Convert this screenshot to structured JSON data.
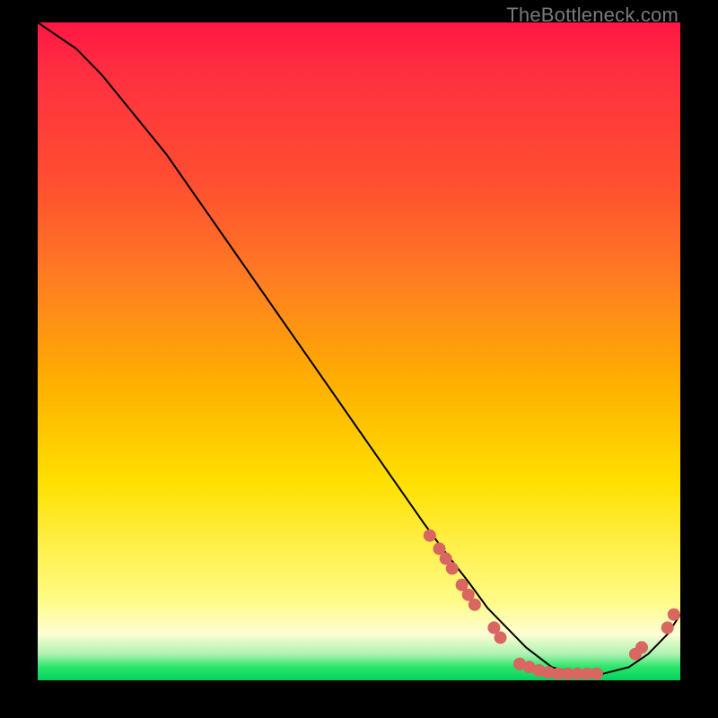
{
  "watermark": "TheBottleneck.com",
  "chart_data": {
    "type": "line",
    "title": "",
    "xlabel": "",
    "ylabel": "",
    "xlim": [
      0,
      100
    ],
    "ylim": [
      0,
      100
    ],
    "grid": false,
    "legend": false,
    "series": [
      {
        "name": "curve",
        "x": [
          0,
          3,
          6,
          10,
          15,
          20,
          25,
          30,
          35,
          40,
          45,
          50,
          55,
          60,
          63,
          67,
          70,
          73,
          76,
          80,
          84,
          88,
          92,
          95,
          98,
          100
        ],
        "y": [
          100,
          98,
          96,
          92,
          86,
          80,
          73,
          66,
          59,
          52,
          45,
          38,
          31,
          24,
          20,
          15,
          11,
          8,
          5,
          2,
          1,
          1,
          2,
          4,
          7,
          10
        ]
      }
    ],
    "markers": [
      {
        "x": 61,
        "y": 22
      },
      {
        "x": 62.5,
        "y": 20
      },
      {
        "x": 63.5,
        "y": 18.5
      },
      {
        "x": 64.5,
        "y": 17
      },
      {
        "x": 66,
        "y": 14.5
      },
      {
        "x": 67,
        "y": 13
      },
      {
        "x": 68,
        "y": 11.5
      },
      {
        "x": 71,
        "y": 8
      },
      {
        "x": 72,
        "y": 6.5
      },
      {
        "x": 75,
        "y": 2.5
      },
      {
        "x": 76.5,
        "y": 2
      },
      {
        "x": 78,
        "y": 1.5
      },
      {
        "x": 79.5,
        "y": 1.2
      },
      {
        "x": 81,
        "y": 1
      },
      {
        "x": 82.5,
        "y": 1
      },
      {
        "x": 84,
        "y": 1
      },
      {
        "x": 85.5,
        "y": 1
      },
      {
        "x": 87,
        "y": 1
      },
      {
        "x": 93,
        "y": 4
      },
      {
        "x": 94,
        "y": 5
      },
      {
        "x": 98,
        "y": 8
      },
      {
        "x": 99,
        "y": 10
      }
    ]
  }
}
